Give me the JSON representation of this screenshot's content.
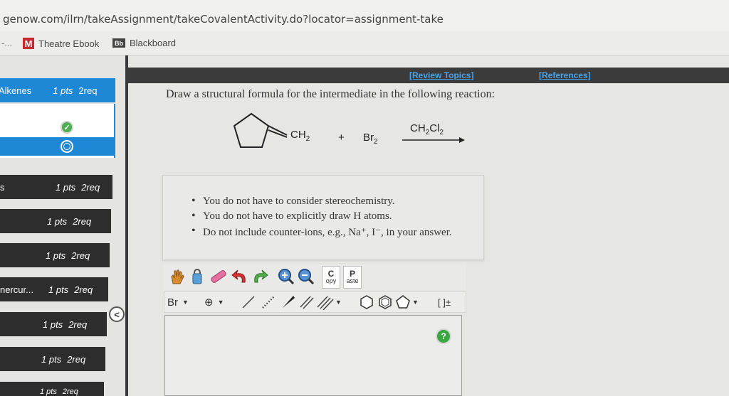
{
  "browser": {
    "url": "genow.com/ilrn/takeAssignment/takeCovalentActivity.do?locator=assignment-take",
    "bookmarks": [
      {
        "label": "Theatre Ebook",
        "icon": "m-logo-icon"
      },
      {
        "label": "Blackboard",
        "icon": "blackboard-icon"
      }
    ],
    "ellipsis": "-..."
  },
  "sidebar": {
    "active_item": {
      "name": "Alkenes",
      "pts": "1 pts",
      "req": "2req"
    },
    "items": [
      {
        "name": "s",
        "pts": "1 pts",
        "req": "2req"
      },
      {
        "name": "",
        "pts": "1 pts",
        "req": "2req"
      },
      {
        "name": "",
        "pts": "1 pts",
        "req": "2req"
      },
      {
        "name": "nercur...",
        "pts": "1 pts",
        "req": "2req"
      },
      {
        "name": "",
        "pts": "1 pts",
        "req": "2req"
      },
      {
        "name": "",
        "pts": "1 pts",
        "req": "2req"
      },
      {
        "name": "",
        "pts": "1 pts",
        "req": "2req"
      }
    ],
    "collapse_glyph": "<"
  },
  "topbar": {
    "review_topics": "[Review Topics]",
    "references": "[References]"
  },
  "question": {
    "prompt": "Draw a structural formula for the intermediate in the following reaction:",
    "reaction": {
      "reactant_group": "CH",
      "reactant_sub": "2",
      "plus": "+",
      "reagent": "Br",
      "reagent_sub": "2",
      "solvent": "CH",
      "solvent_sub1": "2",
      "solvent_mid": "Cl",
      "solvent_sub2": "2"
    },
    "notes": [
      "You do not have to consider stereochemistry.",
      "You do not have to explicitly draw H atoms.",
      "Do not include counter-ions, e.g., Na⁺, I⁻, in your answer."
    ]
  },
  "editor": {
    "copy_label_top": "C",
    "copy_label_bottom": "opy",
    "paste_label_top": "P",
    "paste_label_bottom": "aste",
    "element_select": "Br",
    "charge_glyph": "[ ]±",
    "help_glyph": "?"
  }
}
